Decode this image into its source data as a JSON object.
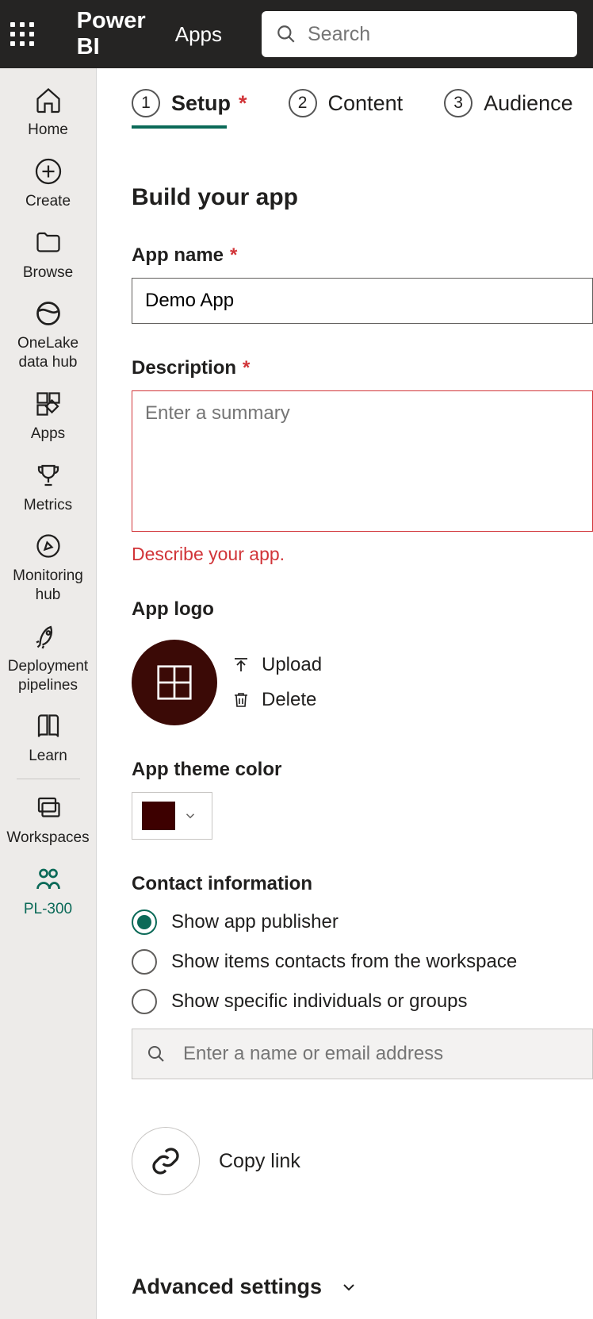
{
  "topbar": {
    "brand": "Power BI",
    "section": "Apps",
    "search_placeholder": "Search"
  },
  "nav": {
    "items": [
      {
        "label": "Home"
      },
      {
        "label": "Create"
      },
      {
        "label": "Browse"
      },
      {
        "label": "OneLake data hub"
      },
      {
        "label": "Apps"
      },
      {
        "label": "Metrics"
      },
      {
        "label": "Monitoring hub"
      },
      {
        "label": "Deployment pipelines"
      },
      {
        "label": "Learn"
      },
      {
        "label": "Workspaces"
      },
      {
        "label": "PL-300"
      }
    ]
  },
  "steps": {
    "s1": {
      "num": "1",
      "label": "Setup"
    },
    "s2": {
      "num": "2",
      "label": "Content"
    },
    "s3": {
      "num": "3",
      "label": "Audience"
    }
  },
  "page_title": "Build your app",
  "app_name": {
    "label": "App name",
    "value": "Demo App"
  },
  "description": {
    "label": "Description",
    "placeholder": "Enter a summary",
    "error": "Describe your app."
  },
  "logo": {
    "label": "App logo",
    "upload": "Upload",
    "delete": "Delete"
  },
  "theme": {
    "label": "App theme color",
    "color": "#3d0000"
  },
  "contact": {
    "label": "Contact information",
    "options": {
      "o1": "Show app publisher",
      "o2": "Show items contacts from the workspace",
      "o3": "Show specific individuals or groups"
    },
    "placeholder": "Enter a name or email address"
  },
  "copy_link": "Copy link",
  "advanced": "Advanced settings"
}
